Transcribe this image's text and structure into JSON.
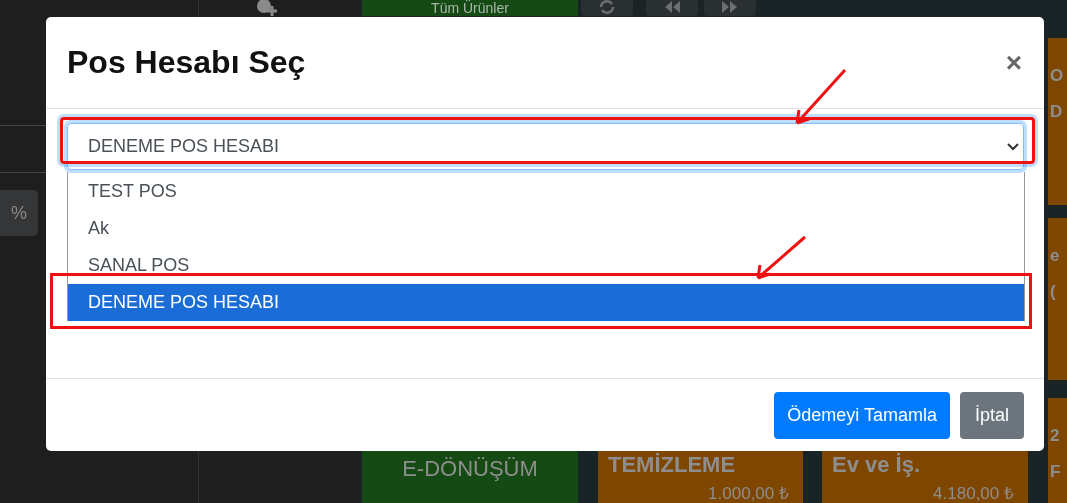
{
  "background": {
    "top_tile": "Tüm Ürünler",
    "percent_button": "%",
    "bottom_tiles": [
      {
        "kind": "category",
        "title": "E-DÖNÜŞÜM"
      },
      {
        "kind": "product",
        "title": "TEMİZLEME",
        "price": "1.000,00 ₺"
      },
      {
        "kind": "product",
        "title": "Ev ve İş.",
        "price": "4.180,00 ₺"
      }
    ],
    "side_tiles": [
      {
        "lines": [
          "O",
          "D"
        ]
      },
      {
        "lines": [
          "e",
          "("
        ]
      },
      {
        "lines": [
          "2",
          "F"
        ]
      }
    ]
  },
  "modal": {
    "title": "Pos Hesabı Seç",
    "close": "×",
    "select": {
      "value": "DENEME POS HESABI",
      "expanded": true,
      "options": [
        {
          "label": "TEST POS",
          "selected": false
        },
        {
          "label": "Ak",
          "selected": false
        },
        {
          "label": "SANAL POS",
          "selected": false
        },
        {
          "label": "DENEME POS HESABI",
          "selected": true
        }
      ]
    },
    "buttons": [
      {
        "label": "Ödemeyi Tamamla",
        "kind": "primary"
      },
      {
        "label": "İptal",
        "kind": "secondary"
      }
    ]
  },
  "annotations": [
    {
      "kind": "box-arrow"
    },
    {
      "kind": "box-arrow"
    }
  ]
}
